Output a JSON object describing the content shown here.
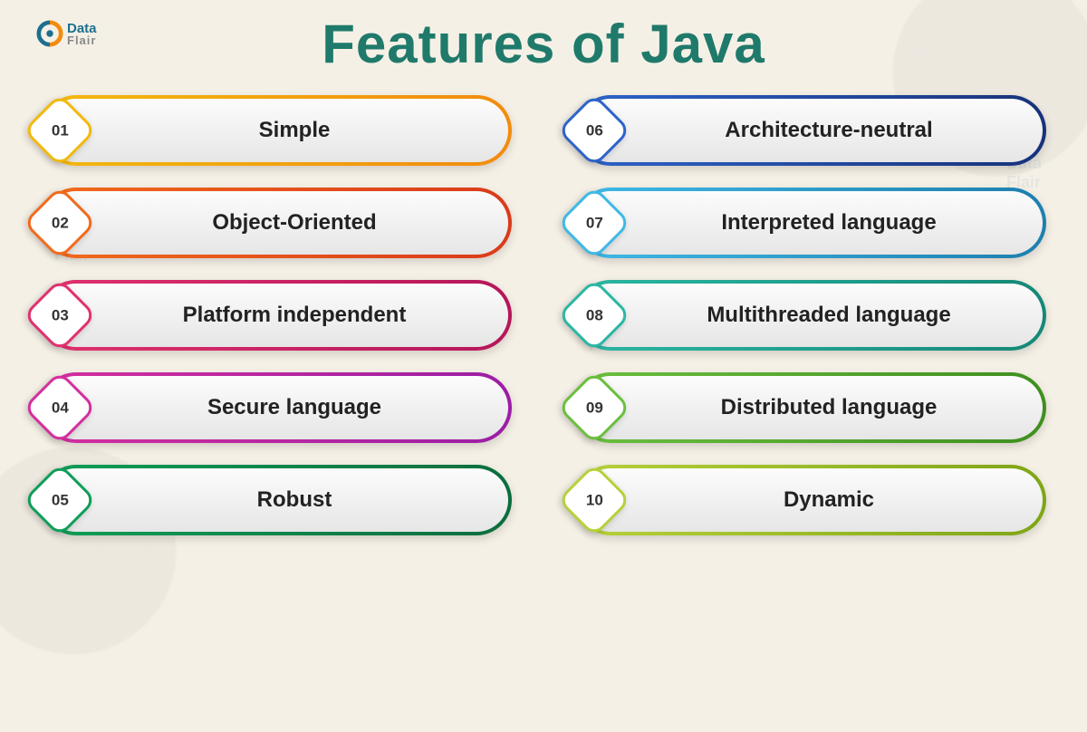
{
  "brand": {
    "line1": "Data",
    "line2": "Flair"
  },
  "title": "Features of Java",
  "features": [
    {
      "num": "01",
      "label": "Simple",
      "c1": "#f2b90e",
      "c2": "#f28b0e"
    },
    {
      "num": "02",
      "label": "Object-Oriented",
      "c1": "#f26a1b",
      "c2": "#d93b1b"
    },
    {
      "num": "03",
      "label": "Platform independent",
      "c1": "#e0316e",
      "c2": "#b5165a"
    },
    {
      "num": "04",
      "label": "Secure language",
      "c1": "#d42f9e",
      "c2": "#9b1ea5"
    },
    {
      "num": "05",
      "label": "Robust",
      "c1": "#0f9e58",
      "c2": "#0b6d3e"
    },
    {
      "num": "06",
      "label": "Architecture-neutral",
      "c1": "#2e63c9",
      "c2": "#18327a"
    },
    {
      "num": "07",
      "label": "Interpreted language",
      "c1": "#3fb9e6",
      "c2": "#1d7fae"
    },
    {
      "num": "08",
      "label": "Multithreaded language",
      "c1": "#2bb7a3",
      "c2": "#158877"
    },
    {
      "num": "09",
      "label": "Distributed language",
      "c1": "#6bbf3f",
      "c2": "#3f8f1f"
    },
    {
      "num": "10",
      "label": "Dynamic",
      "c1": "#b6d13a",
      "c2": "#7fa516"
    }
  ]
}
